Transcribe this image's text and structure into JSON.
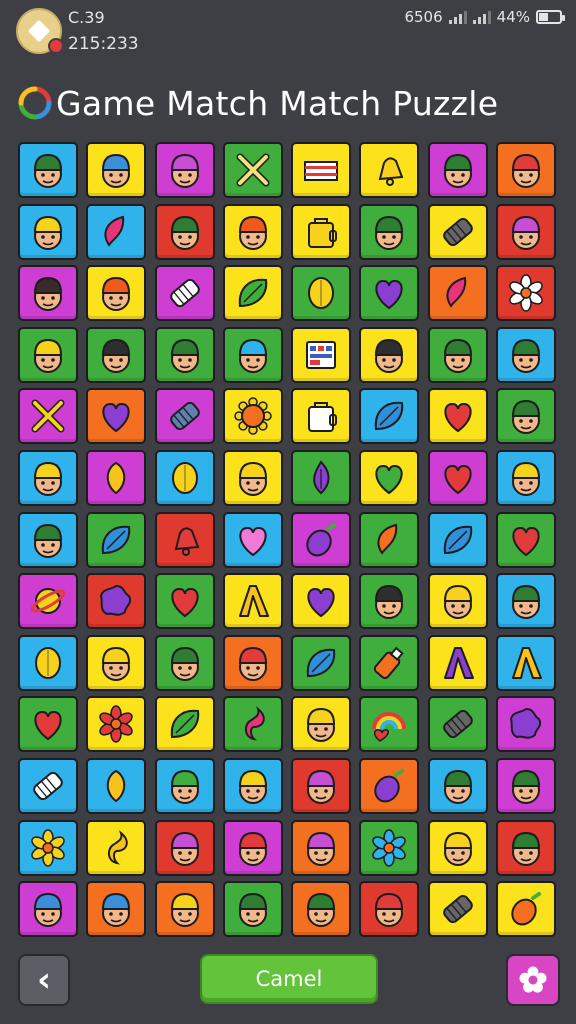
{
  "status": {
    "line1": "C.39",
    "line2": "215:233",
    "network": "6506",
    "battery": "44%"
  },
  "title": "Game Match Match Puzzle",
  "buttons": {
    "back_icon": "chevron-left-icon",
    "main_label": "Camel",
    "menu_icon": "flower-icon"
  },
  "tile_colors": {
    "blue": "#2fb3ea",
    "yellow": "#fbe21a",
    "magenta": "#cf3ed3",
    "green": "#3fae3d",
    "orange": "#f46f1f",
    "red": "#e0392d"
  },
  "grid": [
    [
      {
        "bg": "blue",
        "icon": "face",
        "hat": "#2e7d32"
      },
      {
        "bg": "yellow",
        "icon": "face",
        "hat": "#3a8fd8"
      },
      {
        "bg": "magenta",
        "icon": "face",
        "hat": "#c74fd3"
      },
      {
        "bg": "green",
        "icon": "cross-tools",
        "fill": "#f3e27a"
      },
      {
        "bg": "yellow",
        "icon": "flag",
        "fill": "#e23b3b"
      },
      {
        "bg": "yellow",
        "icon": "bell",
        "fill": "#f7d21c"
      },
      {
        "bg": "magenta",
        "icon": "face",
        "hat": "#2e7d32"
      },
      {
        "bg": "orange",
        "icon": "face",
        "hat": "#e23b3b"
      }
    ],
    [
      {
        "bg": "blue",
        "icon": "face",
        "hat": "#f7d21c"
      },
      {
        "bg": "blue",
        "icon": "drop",
        "fill": "#e8357a"
      },
      {
        "bg": "red",
        "icon": "face",
        "hat": "#2e7d32"
      },
      {
        "bg": "yellow",
        "icon": "face",
        "hat": "#f05a1c"
      },
      {
        "bg": "yellow",
        "icon": "bag",
        "fill": "#f7d21c"
      },
      {
        "bg": "green",
        "icon": "face",
        "hat": "#2e7d32"
      },
      {
        "bg": "yellow",
        "icon": "roll",
        "fill": "#666"
      },
      {
        "bg": "red",
        "icon": "face",
        "hat": "#c74fd3"
      }
    ],
    [
      {
        "bg": "magenta",
        "icon": "face",
        "hat": "#3a2a2a"
      },
      {
        "bg": "yellow",
        "icon": "face",
        "hat": "#f05a1c"
      },
      {
        "bg": "magenta",
        "icon": "roll",
        "fill": "#ffffff"
      },
      {
        "bg": "yellow",
        "icon": "leaf",
        "fill": "#3fae3d"
      },
      {
        "bg": "green",
        "icon": "lemon",
        "fill": "#f7d21c"
      },
      {
        "bg": "green",
        "icon": "heart",
        "fill": "#8a3fd1"
      },
      {
        "bg": "orange",
        "icon": "drop",
        "fill": "#e8357a"
      },
      {
        "bg": "red",
        "icon": "flower",
        "fill": "#ffffff"
      }
    ],
    [
      {
        "bg": "green",
        "icon": "face",
        "hat": "#f7d21c"
      },
      {
        "bg": "green",
        "icon": "face",
        "hat": "#2e2e2e"
      },
      {
        "bg": "green",
        "icon": "face",
        "hat": "#2e7d32"
      },
      {
        "bg": "green",
        "icon": "face",
        "hat": "#2fb3ea"
      },
      {
        "bg": "yellow",
        "icon": "board",
        "fill": "#3a5fb8"
      },
      {
        "bg": "yellow",
        "icon": "face",
        "hat": "#2e2e2e"
      },
      {
        "bg": "green",
        "icon": "face",
        "hat": "#2e7d32"
      },
      {
        "bg": "blue",
        "icon": "face",
        "hat": "#2e7d32"
      }
    ],
    [
      {
        "bg": "magenta",
        "icon": "cross-tools",
        "fill": "#f7d21c"
      },
      {
        "bg": "orange",
        "icon": "heart",
        "fill": "#8a3fd1"
      },
      {
        "bg": "magenta",
        "icon": "roll",
        "fill": "#5e7fb0"
      },
      {
        "bg": "yellow",
        "icon": "sun",
        "fill": "#f46f1f"
      },
      {
        "bg": "yellow",
        "icon": "bag",
        "fill": "#ffffff"
      },
      {
        "bg": "blue",
        "icon": "leaf",
        "fill": "#2f8fd8"
      },
      {
        "bg": "yellow",
        "icon": "heart",
        "fill": "#e23b3b"
      },
      {
        "bg": "green",
        "icon": "face",
        "hat": "#2e7d32"
      }
    ],
    [
      {
        "bg": "blue",
        "icon": "face",
        "hat": "#f7d21c"
      },
      {
        "bg": "magenta",
        "icon": "mango",
        "fill": "#f7c21c"
      },
      {
        "bg": "blue",
        "icon": "lemon",
        "fill": "#f7d21c"
      },
      {
        "bg": "yellow",
        "icon": "face",
        "hat": "#f7d21c"
      },
      {
        "bg": "green",
        "icon": "flame",
        "fill": "#8a3fd1"
      },
      {
        "bg": "yellow",
        "icon": "heart",
        "fill": "#3fae3d"
      },
      {
        "bg": "magenta",
        "icon": "heart",
        "fill": "#e23b3b"
      },
      {
        "bg": "blue",
        "icon": "face",
        "hat": "#f7d21c"
      }
    ],
    [
      {
        "bg": "blue",
        "icon": "face",
        "hat": "#2e7d32"
      },
      {
        "bg": "green",
        "icon": "leaf",
        "fill": "#2f8fd8"
      },
      {
        "bg": "red",
        "icon": "bell",
        "fill": "#e23b3b"
      },
      {
        "bg": "blue",
        "icon": "heart",
        "fill": "#f07ad8"
      },
      {
        "bg": "magenta",
        "icon": "eggplant",
        "fill": "#8a3fd1"
      },
      {
        "bg": "green",
        "icon": "drop",
        "fill": "#f46f1f"
      },
      {
        "bg": "blue",
        "icon": "leaf",
        "fill": "#2f8fd8"
      },
      {
        "bg": "green",
        "icon": "heart",
        "fill": "#e23b3b"
      }
    ],
    [
      {
        "bg": "magenta",
        "icon": "planet",
        "fill": "#f7d21c"
      },
      {
        "bg": "red",
        "icon": "blob",
        "fill": "#8a3fd1"
      },
      {
        "bg": "green",
        "icon": "heart",
        "fill": "#e23b3b"
      },
      {
        "bg": "yellow",
        "icon": "lambda",
        "fill": "#f7c21c"
      },
      {
        "bg": "yellow",
        "icon": "heart",
        "fill": "#8a3fd1"
      },
      {
        "bg": "green",
        "icon": "face",
        "hat": "#2e2e2e"
      },
      {
        "bg": "yellow",
        "icon": "face",
        "hat": "#f7d21c"
      },
      {
        "bg": "blue",
        "icon": "face",
        "hat": "#2e7d32"
      }
    ],
    [
      {
        "bg": "blue",
        "icon": "lemon",
        "fill": "#f7d21c"
      },
      {
        "bg": "yellow",
        "icon": "face",
        "hat": "#f7d21c"
      },
      {
        "bg": "green",
        "icon": "face",
        "hat": "#2e7d32"
      },
      {
        "bg": "orange",
        "icon": "face",
        "hat": "#e23b3b"
      },
      {
        "bg": "green",
        "icon": "leaf",
        "fill": "#2f8fd8"
      },
      {
        "bg": "green",
        "icon": "bottle",
        "fill": "#f46f1f"
      },
      {
        "bg": "yellow",
        "icon": "lambda",
        "fill": "#8a3fd1"
      },
      {
        "bg": "blue",
        "icon": "lambda",
        "fill": "#f7c21c"
      }
    ],
    [
      {
        "bg": "green",
        "icon": "heart",
        "fill": "#e23b3b"
      },
      {
        "bg": "yellow",
        "icon": "flower",
        "fill": "#e23b3b"
      },
      {
        "bg": "yellow",
        "icon": "leaf",
        "fill": "#3fae3d"
      },
      {
        "bg": "green",
        "icon": "hook",
        "fill": "#e8357a"
      },
      {
        "bg": "yellow",
        "icon": "face",
        "hat": "#f7d21c"
      },
      {
        "bg": "green",
        "icon": "rainbow",
        "fill": "#e23b3b"
      },
      {
        "bg": "green",
        "icon": "roll",
        "fill": "#666"
      },
      {
        "bg": "magenta",
        "icon": "blob",
        "fill": "#8a3fd1"
      }
    ],
    [
      {
        "bg": "blue",
        "icon": "roll",
        "fill": "#ffffff"
      },
      {
        "bg": "blue",
        "icon": "mango",
        "fill": "#f7c21c"
      },
      {
        "bg": "blue",
        "icon": "face",
        "hat": "#3fae3d"
      },
      {
        "bg": "blue",
        "icon": "face",
        "hat": "#f7d21c"
      },
      {
        "bg": "red",
        "icon": "face",
        "hat": "#c74fd3"
      },
      {
        "bg": "orange",
        "icon": "eggplant",
        "fill": "#8a3fd1"
      },
      {
        "bg": "blue",
        "icon": "face",
        "hat": "#2e7d32"
      },
      {
        "bg": "magenta",
        "icon": "face",
        "hat": "#2e7d32"
      }
    ],
    [
      {
        "bg": "blue",
        "icon": "flower",
        "fill": "#f7d21c"
      },
      {
        "bg": "yellow",
        "icon": "hook",
        "fill": "#f7c21c"
      },
      {
        "bg": "red",
        "icon": "face",
        "hat": "#c74fd3"
      },
      {
        "bg": "magenta",
        "icon": "face",
        "hat": "#e23b3b"
      },
      {
        "bg": "orange",
        "icon": "face",
        "hat": "#c74fd3"
      },
      {
        "bg": "green",
        "icon": "flower",
        "fill": "#2fb3ea"
      },
      {
        "bg": "yellow",
        "icon": "face",
        "hat": "#f7d21c"
      },
      {
        "bg": "red",
        "icon": "face",
        "hat": "#2e7d32"
      }
    ],
    [
      {
        "bg": "magenta",
        "icon": "face",
        "hat": "#3a8fd8"
      },
      {
        "bg": "orange",
        "icon": "face",
        "hat": "#3a8fd8"
      },
      {
        "bg": "orange",
        "icon": "face",
        "hat": "#f7d21c"
      },
      {
        "bg": "green",
        "icon": "face",
        "hat": "#2e7d32"
      },
      {
        "bg": "orange",
        "icon": "face",
        "hat": "#2e7d32"
      },
      {
        "bg": "red",
        "icon": "face",
        "hat": "#e23b3b"
      },
      {
        "bg": "yellow",
        "icon": "roll",
        "fill": "#666"
      },
      {
        "bg": "yellow",
        "icon": "eggplant",
        "fill": "#f46f1f"
      }
    ]
  ]
}
